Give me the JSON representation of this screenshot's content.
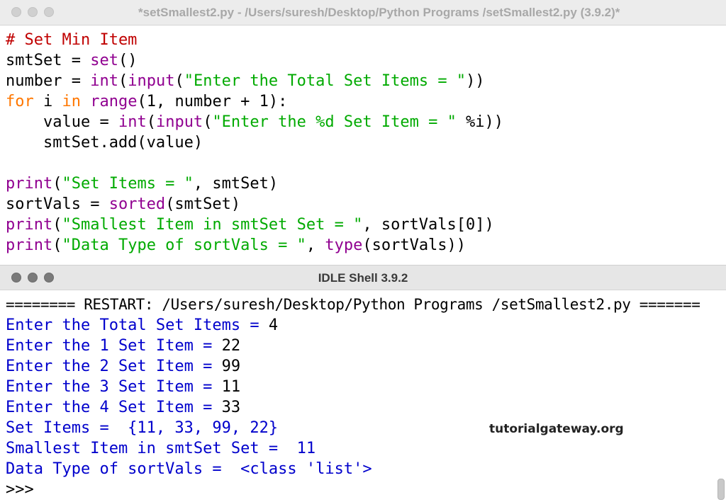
{
  "editor_window": {
    "title": "*setSmallest2.py - /Users/suresh/Desktop/Python Programs /setSmallest2.py (3.9.2)*"
  },
  "code": {
    "l1": "# Set Min Item",
    "l2a": "smtSet = ",
    "l2b": "set",
    "l2c": "()",
    "l3a": "number = ",
    "l3b": "int",
    "l3c": "(",
    "l3d": "input",
    "l3e": "(",
    "l3f": "\"Enter the Total Set Items = \"",
    "l3g": "))",
    "l4a": "for",
    "l4b": " i ",
    "l4c": "in",
    "l4d": " ",
    "l4e": "range",
    "l4f": "(1, number + 1):",
    "l5a": "    value = ",
    "l5b": "int",
    "l5c": "(",
    "l5d": "input",
    "l5e": "(",
    "l5f": "\"Enter the %d Set Item = \"",
    "l5g": " %i))",
    "l6": "    smtSet.add(value)",
    "l8a": "print",
    "l8b": "(",
    "l8c": "\"Set Items = \"",
    "l8d": ", smtSet)",
    "l9a": "sortVals = ",
    "l9b": "sorted",
    "l9c": "(smtSet)",
    "l10a": "print",
    "l10b": "(",
    "l10c": "\"Smallest Item in smtSet Set = \"",
    "l10d": ", sortVals[0])",
    "l11a": "print",
    "l11b": "(",
    "l11c": "\"Data Type of sortVals = \"",
    "l11d": ", ",
    "l11e": "type",
    "l11f": "(sortVals))"
  },
  "shell_window": {
    "title": "IDLE Shell 3.9.2"
  },
  "shell": {
    "restart": "======== RESTART: /Users/suresh/Desktop/Python Programs /setSmallest2.py =======",
    "p1": "Enter the Total Set Items = ",
    "v1": "4",
    "p2": "Enter the 1 Set Item = ",
    "v2": "22",
    "p3": "Enter the 2 Set Item = ",
    "v3": "99",
    "p4": "Enter the 3 Set Item = ",
    "v4": "11",
    "p5": "Enter the 4 Set Item = ",
    "v5": "33",
    "o1": "Set Items =  {11, 33, 99, 22}",
    "o2": "Smallest Item in smtSet Set =  11",
    "o3": "Data Type of sortVals =  <class 'list'>",
    "prompt": ">>>"
  },
  "watermark": "tutorialgateway.org"
}
